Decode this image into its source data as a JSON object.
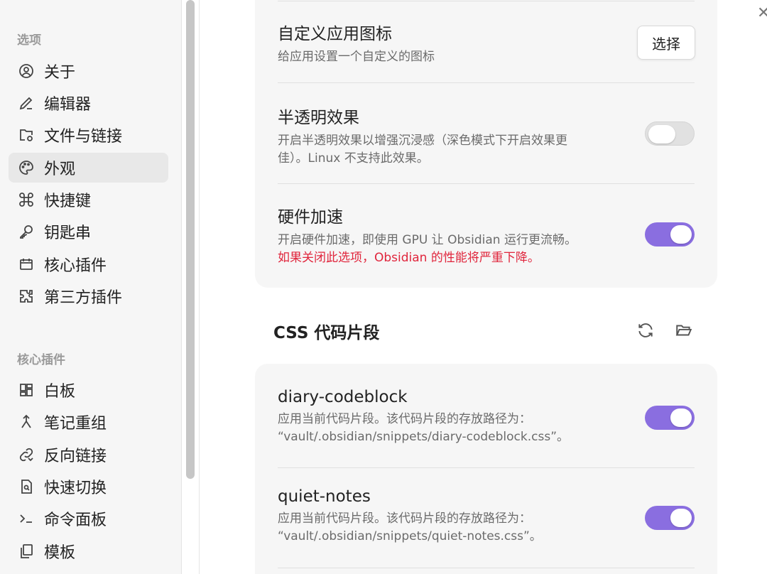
{
  "sidebar": {
    "sections": [
      {
        "title": "选项",
        "items": [
          {
            "label": "关于",
            "icon": "info-circle-icon"
          },
          {
            "label": "编辑器",
            "icon": "pen-icon"
          },
          {
            "label": "文件与链接",
            "icon": "folder-cog-icon"
          },
          {
            "label": "外观",
            "icon": "palette-icon",
            "active": true
          },
          {
            "label": "快捷键",
            "icon": "command-icon"
          },
          {
            "label": "钥匙串",
            "icon": "key-icon"
          },
          {
            "label": "核心插件",
            "icon": "calendar-icon"
          },
          {
            "label": "第三方插件",
            "icon": "puzzle-icon"
          }
        ]
      },
      {
        "title": "核心插件",
        "items": [
          {
            "label": "白板",
            "icon": "layout-icon"
          },
          {
            "label": "笔记重组",
            "icon": "merge-icon"
          },
          {
            "label": "反向链接",
            "icon": "link-icon"
          },
          {
            "label": "快速切换",
            "icon": "search-file-icon"
          },
          {
            "label": "命令面板",
            "icon": "terminal-icon"
          },
          {
            "label": "模板",
            "icon": "copy-icon"
          }
        ]
      }
    ]
  },
  "appearance": {
    "custom_icon": {
      "title": "自定义应用图标",
      "desc": "给应用设置一个自定义的图标",
      "button": "选择"
    },
    "translucent": {
      "title": "半透明效果",
      "desc_line1": "开启半透明效果以增强沉浸感（深色模式下开启效果更",
      "desc_line2": "佳）。Linux 不支持此效果。",
      "enabled": false
    },
    "hardware": {
      "title": "硬件加速",
      "desc": "开启硬件加速，即使用 GPU 让 Obsidian 运行更流畅。",
      "warning": "如果关闭此选项，Obsidian 的性能将严重下降。",
      "enabled": true
    }
  },
  "css_snippets": {
    "heading": "CSS 代码片段",
    "items": [
      {
        "name": "diary-codeblock",
        "desc_line1": "应用当前代码片段。该代码片段的存放路径为：",
        "desc_line2": "“vault/.obsidian/snippets/diary-codeblock.css”。",
        "enabled": true
      },
      {
        "name": "quiet-notes",
        "desc_line1": "应用当前代码片段。该代码片段的存放路径为：",
        "desc_line2": "“vault/.obsidian/snippets/quiet-notes.css”。",
        "enabled": true
      }
    ]
  },
  "colors": {
    "accent": "#8a6ee0",
    "warning": "#e0253c"
  }
}
